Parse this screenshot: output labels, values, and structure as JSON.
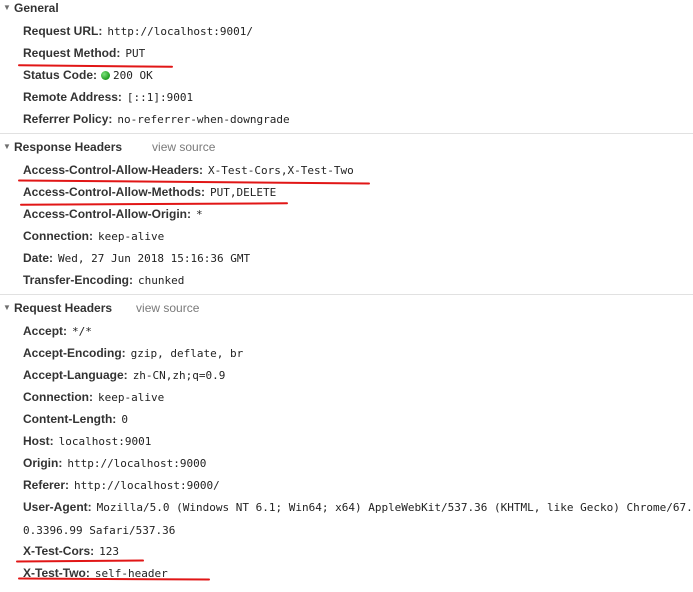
{
  "general": {
    "title": "General",
    "rows": [
      {
        "key": "Request URL:",
        "value": "http://localhost:9001/"
      },
      {
        "key": "Request Method:",
        "value": "PUT"
      },
      {
        "key": "Status Code:",
        "value": "200 OK"
      },
      {
        "key": "Remote Address:",
        "value": "[::1]:9001"
      },
      {
        "key": "Referrer Policy:",
        "value": "no-referrer-when-downgrade"
      }
    ]
  },
  "response_headers": {
    "title": "Response Headers",
    "view_source": "view source",
    "rows": [
      {
        "key": "Access-Control-Allow-Headers:",
        "value": "X-Test-Cors,X-Test-Two"
      },
      {
        "key": "Access-Control-Allow-Methods:",
        "value": "PUT,DELETE"
      },
      {
        "key": "Access-Control-Allow-Origin:",
        "value": "*"
      },
      {
        "key": "Connection:",
        "value": "keep-alive"
      },
      {
        "key": "Date:",
        "value": "Wed, 27 Jun 2018 15:16:36 GMT"
      },
      {
        "key": "Transfer-Encoding:",
        "value": "chunked"
      }
    ]
  },
  "request_headers": {
    "title": "Request Headers",
    "view_source": "view source",
    "rows": [
      {
        "key": "Accept:",
        "value": "*/*"
      },
      {
        "key": "Accept-Encoding:",
        "value": "gzip, deflate, br"
      },
      {
        "key": "Accept-Language:",
        "value": "zh-CN,zh;q=0.9"
      },
      {
        "key": "Connection:",
        "value": "keep-alive"
      },
      {
        "key": "Content-Length:",
        "value": "0"
      },
      {
        "key": "Host:",
        "value": "localhost:9001"
      },
      {
        "key": "Origin:",
        "value": "http://localhost:9000"
      },
      {
        "key": "Referer:",
        "value": "http://localhost:9000/"
      },
      {
        "key": "User-Agent:",
        "value": "Mozilla/5.0 (Windows NT 6.1; Win64; x64) AppleWebKit/537.36 (KHTML, like Gecko) Chrome/67.0.3396.99 Safari/537.36"
      },
      {
        "key": "X-Test-Cors:",
        "value": "123"
      },
      {
        "key": "X-Test-Two:",
        "value": "self-header"
      }
    ]
  },
  "colors": {
    "annotation_underline": "#e11616",
    "status_ok": "#1f9b1f"
  },
  "icons": {
    "section_toggle": "triangle-down-icon",
    "status": "green-dot-icon"
  }
}
